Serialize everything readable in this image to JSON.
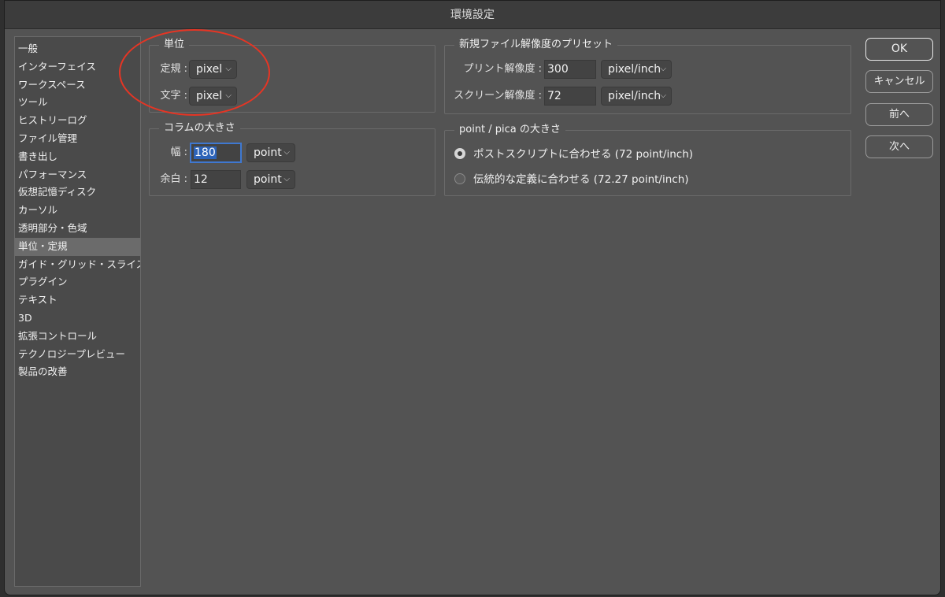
{
  "window": {
    "title": "環境設定"
  },
  "sidebar": {
    "items": [
      {
        "label": "一般"
      },
      {
        "label": "インターフェイス"
      },
      {
        "label": "ワークスペース"
      },
      {
        "label": "ツール"
      },
      {
        "label": "ヒストリーログ"
      },
      {
        "label": "ファイル管理"
      },
      {
        "label": "書き出し"
      },
      {
        "label": "パフォーマンス"
      },
      {
        "label": "仮想記憶ディスク"
      },
      {
        "label": "カーソル"
      },
      {
        "label": "透明部分・色域"
      },
      {
        "label": "単位・定規",
        "selected": true
      },
      {
        "label": "ガイド・グリッド・スライス"
      },
      {
        "label": "プラグイン"
      },
      {
        "label": "テキスト"
      },
      {
        "label": "3D"
      },
      {
        "label": "拡張コントロール"
      },
      {
        "label": "テクノロジープレビュー"
      },
      {
        "label": "製品の改善"
      }
    ]
  },
  "units": {
    "title": "単位",
    "rulers_label": "定規 :",
    "rulers_value": "pixel",
    "type_label": "文字 :",
    "type_value": "pixel"
  },
  "column": {
    "title": "コラムの大きさ",
    "width_label": "幅 :",
    "width_value": "180",
    "width_unit": "point",
    "gutter_label": "余白 :",
    "gutter_value": "12",
    "gutter_unit": "point"
  },
  "resolution": {
    "title": "新規ファイル解像度のプリセット",
    "print_label": "プリント解像度 :",
    "print_value": "300",
    "print_unit": "pixel/inch",
    "screen_label": "スクリーン解像度 :",
    "screen_value": "72",
    "screen_unit": "pixel/inch"
  },
  "pointpica": {
    "title": "point / pica の大きさ",
    "option1": "ポストスクリプトに合わせる (72 point/inch)",
    "option2": "伝統的な定義に合わせる (72.27 point/inch)",
    "selected": 1
  },
  "buttons": {
    "ok": "OK",
    "cancel": "キャンセル",
    "prev": "前へ",
    "next": "次へ"
  },
  "colors": {
    "dialog_bg": "#535353",
    "annotation": "#e63524",
    "focus": "#3f78d1"
  }
}
